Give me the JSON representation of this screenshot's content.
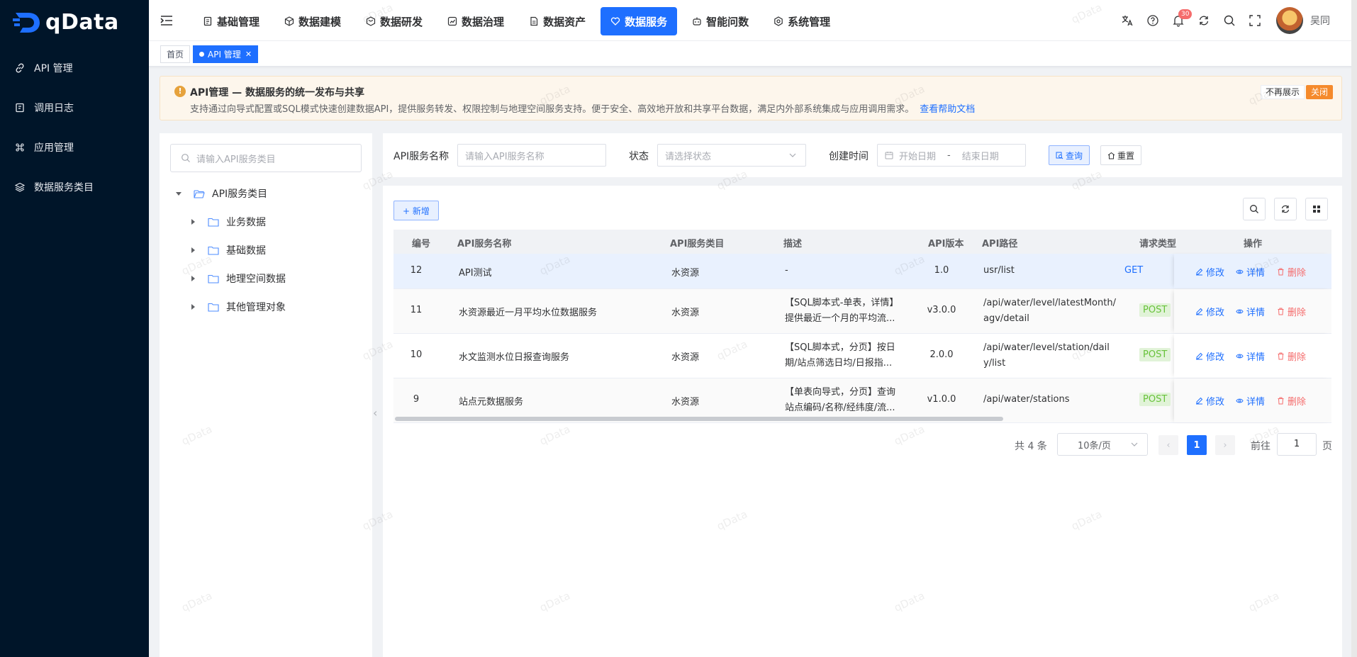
{
  "brand": {
    "name": "qData"
  },
  "sidebar": {
    "items": [
      {
        "label": "API 管理",
        "icon": "link-icon"
      },
      {
        "label": "调用日志",
        "icon": "log-icon"
      },
      {
        "label": "应用管理",
        "icon": "command-icon"
      },
      {
        "label": "数据服务类目",
        "icon": "layers-icon"
      }
    ]
  },
  "topnav": {
    "items": [
      {
        "label": "基础管理",
        "icon": "doc-icon"
      },
      {
        "label": "数据建模",
        "icon": "cube-icon"
      },
      {
        "label": "数据研发",
        "icon": "box-icon"
      },
      {
        "label": "数据治理",
        "icon": "shield-icon"
      },
      {
        "label": "数据资产",
        "icon": "asset-icon"
      },
      {
        "label": "数据服务",
        "icon": "heart-icon",
        "active": true
      },
      {
        "label": "智能问数",
        "icon": "robot-icon"
      },
      {
        "label": "系统管理",
        "icon": "settings-icon"
      }
    ],
    "notification_count": "30",
    "username": "吴同"
  },
  "tags": {
    "home": "首页",
    "current": "API 管理"
  },
  "notice": {
    "title": "API管理 — 数据服务的统一发布与共享",
    "desc": "支持通过向导式配置或SQL模式快速创建数据API，提供服务转发、权限控制与地理空间服务支持。便于安全、高效地开放和共享平台数据，满足内外部系统集成与应用调用需求。",
    "link": "查看帮助文档",
    "hide": "不再展示",
    "close": "关闭"
  },
  "tree": {
    "search_placeholder": "请输入API服务类目",
    "root": "API服务类目",
    "children": [
      "业务数据",
      "基础数据",
      "地理空间数据",
      "其他管理对象"
    ]
  },
  "filters": {
    "name_label": "API服务名称",
    "name_placeholder": "请输入API服务名称",
    "status_label": "状态",
    "status_placeholder": "请选择状态",
    "time_label": "创建时间",
    "start_placeholder": "开始日期",
    "sep": "-",
    "end_placeholder": "结束日期",
    "query": "查询",
    "reset": "重置"
  },
  "table": {
    "add": "+ 新增",
    "headers": [
      "编号",
      "API服务名称",
      "API服务类目",
      "描述",
      "API版本",
      "API路径",
      "请求类型",
      "操作"
    ],
    "rows": [
      {
        "id": "12",
        "name": "API测试",
        "category": "水资源",
        "desc1": "-",
        "desc2": "",
        "version": "1.0",
        "path1": "usr/list",
        "path2": "",
        "method": "GET"
      },
      {
        "id": "11",
        "name": "水资源最近一月平均水位数据服务",
        "category": "水资源",
        "desc1": "【SQL脚本式-单表，详情】",
        "desc2": "提供最近一个月的平均流...",
        "version": "v3.0.0",
        "path1": "/api/water/level/latestMonth/",
        "path2": "agv/detail",
        "method": "POST"
      },
      {
        "id": "10",
        "name": "水文监测水位日报查询服务",
        "category": "水资源",
        "desc1": "【SQL脚本式，分页】按日",
        "desc2": "期/站点筛选日均/日报指...",
        "version": "2.0.0",
        "path1": "/api/water/level/station/dail",
        "path2": "y/list",
        "method": "POST"
      },
      {
        "id": "9",
        "name": "站点元数据服务",
        "category": "水资源",
        "desc1": "【单表向导式，分页】查询",
        "desc2": "站点编码/名称/经纬度/流...",
        "version": "v1.0.0",
        "path1": "/api/water/stations",
        "path2": "",
        "method": "POST"
      }
    ],
    "ops": {
      "edit": "修改",
      "detail": "详情",
      "delete": "删除"
    }
  },
  "pagination": {
    "total": "共 4 条",
    "page_size": "10条/页",
    "current": "1",
    "goto_label": "前往",
    "goto_value": "1",
    "page_unit": "页"
  },
  "watermark": "qData"
}
